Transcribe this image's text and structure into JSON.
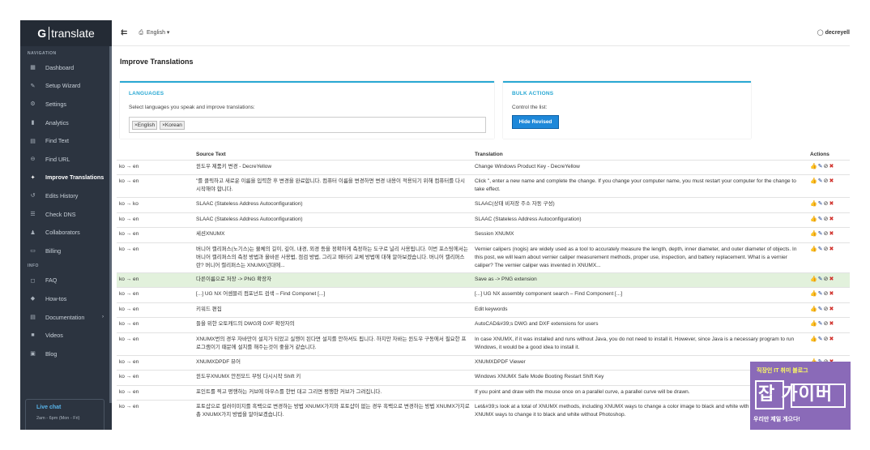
{
  "app": {
    "logo_g": "G",
    "logo_rest": "translate"
  },
  "topbar": {
    "menu_icon": "⇇",
    "language": "English ▾",
    "user": "decreyell"
  },
  "sidebar": {
    "navigation_label": "NAVIGATION",
    "items": [
      {
        "label": "Dashboard",
        "icon": "▦"
      },
      {
        "label": "Setup Wizard",
        "icon": "✎"
      },
      {
        "label": "Settings",
        "icon": "⚙"
      },
      {
        "label": "Analytics",
        "icon": "▮"
      },
      {
        "label": "Find Text",
        "icon": "▤"
      },
      {
        "label": "Find URL",
        "icon": "⊖"
      },
      {
        "label": "Improve Translations",
        "icon": "✦"
      },
      {
        "label": "Edits History",
        "icon": "↺"
      },
      {
        "label": "Check DNS",
        "icon": "☰"
      },
      {
        "label": "Collaborators",
        "icon": "♟"
      },
      {
        "label": "Billing",
        "icon": "▭"
      }
    ],
    "info_label": "INFO",
    "info_items": [
      {
        "label": "FAQ",
        "icon": "◻"
      },
      {
        "label": "How-tos",
        "icon": "◆"
      },
      {
        "label": "Documentation",
        "icon": "▤",
        "chevron": "›"
      },
      {
        "label": "Videos",
        "icon": "■"
      },
      {
        "label": "Blog",
        "icon": "▣"
      }
    ],
    "live_chat": {
      "title": "Live chat",
      "subtitle": "2am - 6pm (Mon - Fri)"
    }
  },
  "page_title": "Improve Translations",
  "languages_card": {
    "title": "LANGUAGES",
    "desc": "Select languages you speak and improve translations:",
    "tags": [
      "×English",
      "×Korean"
    ]
  },
  "bulk_card": {
    "title": "BULK ACTIONS",
    "desc": "Control the list:",
    "button": "Hide Revised"
  },
  "table": {
    "headers": [
      "",
      "Source Text",
      "Translation",
      "Actions"
    ],
    "rows": [
      {
        "lang": "ko → en",
        "src": "윈도우 제품키 변경 - DecreYellow",
        "tr": "Change Windows Product Key - DecreYellow"
      },
      {
        "lang": "ko → en",
        "src": "\"를 클릭하고 새로운 이름을 입력한 후 변경을 완료합니다. 컴퓨터 이름을 변경하면 변경 내용이 적용되기 위해 컴퓨터를 다시 시작해야 합니다.",
        "tr": "Click \", enter a new name and complete the change. If you change your computer name, you must restart your computer for the change to take effect."
      },
      {
        "lang": "ko → ko",
        "src": "SLAAC (Stateless Address Autoconfiguration)",
        "tr": "SLAAC(상태 비저장 주소 자동 구성)"
      },
      {
        "lang": "ko → en",
        "src": "SLAAC (Stateless Address Autoconfiguration)",
        "tr": "SLAAC (Stateless Address Autoconfiguration)"
      },
      {
        "lang": "ko → en",
        "src": "세션XNUMX",
        "tr": "Session XNUMX"
      },
      {
        "lang": "ko → en",
        "src": "버니어 캘리퍼스(노기스)는 물체의 길이, 깊이, 내경, 외경 등을 정확하게 측정하는 도구로 널리 사용됩니다. 이번 포스팅에서는 버니어 캘리퍼스의 측정 방법과 올바른 사용법, 점검 방법, 그리고 배터리 교체 방법에 대해 알아보겠습니다. 버니어 캘리퍼스란? 버니어 캘리퍼스는 XNUMX년대에...",
        "tr": "Vernier calipers (nogis) are widely used as a tool to accurately measure the length, depth, inner diameter, and outer diameter of objects. In this post, we will learn about vernier caliper measurement methods, proper use, inspection, and battery replacement. What is a vernier caliper? The vernier caliper was invented in XNUMX..."
      },
      {
        "lang": "ko → en",
        "src": "다른이름으로 저장 -> PNG 확장자",
        "tr": "Save as -> PNG extension"
      },
      {
        "lang": "ko → en",
        "src": "[...] UG NX 어셈블리 컴포넌트 검색 – Find Componet [...]",
        "tr": "[...] UG NX assembly component search – Find Component [...]"
      },
      {
        "lang": "ko → en",
        "src": "키워드 편집",
        "tr": "Edit keywords"
      },
      {
        "lang": "ko → en",
        "src": "들을 위한 오토캐드의 DWG와 DXF 확장자의",
        "tr": "AutoCAD&#39;s DWG and DXF extensions for users"
      },
      {
        "lang": "ko → en",
        "src": "XNUMX번의 경우 자바만이 설치가 되었고 실행이 된다면 설치를 안하셔도 됩니다. 하지만 자바는 윈도우 구동에서 필요한 프로그램이기 때문에 설치를 해주는것이 좋을거 같습니다.",
        "tr": "In case XNUMX, if it was installed and runs without Java, you do not need to install it. However, since Java is a necessary program to run Windows, it would be a good idea to install it."
      },
      {
        "lang": "ko → en",
        "src": "XNUMXDPDF 뷰어",
        "tr": "XNUMXDPDF Viewer"
      },
      {
        "lang": "ko → en",
        "src": "윈도우XNUMX 안전모드 부팅 다시시작 Shift 키",
        "tr": "Windows XNUMX Safe Mode Booting Restart Shift Key"
      },
      {
        "lang": "ko → en",
        "src": "포인트를 찍고 평행하는 커브에 마우스를 한번 대고 그리면 평행한 커브가 그려집니다.",
        "tr": "If you point and draw with the mouse once on a parallel curve, a parallel curve will be drawn."
      },
      {
        "lang": "ko → en",
        "src": "포토샵으로 컬러이미지를 흑백으로 변경하는 방법 XNUMX가지와 포토샵이 없는 경우 흑백으로 변경하는 방법 XNUMX가지로 총 XNUMX가지 방법을 알아보겠습니다.",
        "tr": "Let&#39;s look at a total of XNUMX methods, including XNUMX ways to change a color image to black and white with Photoshop and XNUMX ways to change it to black and white without Photoshop."
      }
    ]
  },
  "ad": {
    "line1": "직장인 IT 취미 블로그",
    "line2": "잡 가이버",
    "line3": "우리만 제일 게으다!"
  }
}
